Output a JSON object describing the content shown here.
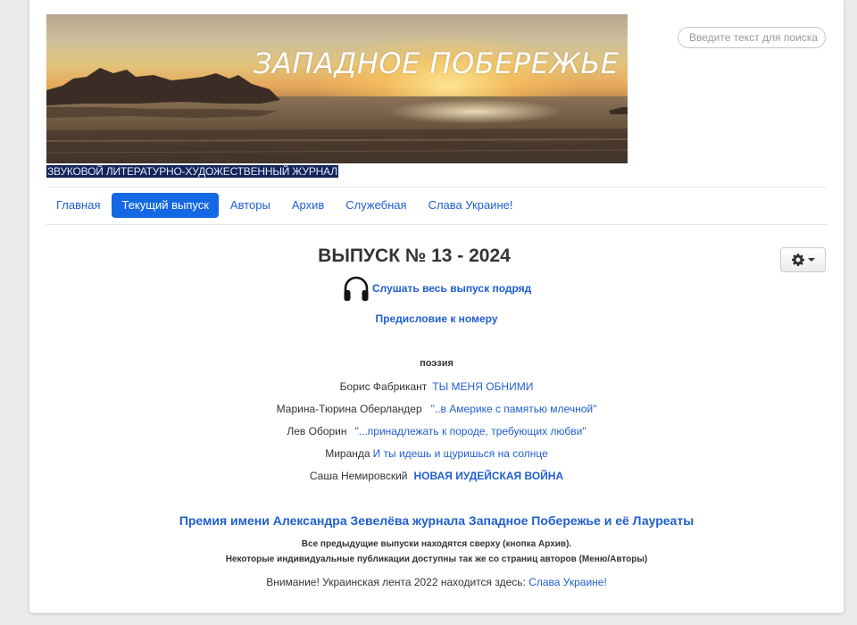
{
  "header": {
    "banner_title": "ЗАПАДНОЕ ПОБЕРЕЖЬЕ",
    "subtitle": "ЗВУКОВОЙ ЛИТЕРАТУРНО-ХУДОЖЕСТВЕННЫЙ ЖУРНАЛ",
    "search_placeholder": "Введите текст для поиска"
  },
  "nav": {
    "tabs": [
      {
        "label": "Главная"
      },
      {
        "label": "Текущий выпуск",
        "active": true
      },
      {
        "label": "Авторы"
      },
      {
        "label": "Архив"
      },
      {
        "label": "Служебная"
      },
      {
        "label": "Слава Украине!"
      }
    ]
  },
  "toolbar": {
    "gear_icon": "gear-icon",
    "caret_icon": "caret-down-icon"
  },
  "main": {
    "issue_title": "ВЫПУСК № 13 - 2024",
    "listen_icon": "headphones-icon",
    "listen_label": "Слушать весь выпуск подряд",
    "preface_label": "Предисловие к номеру",
    "section_title": "поэзия",
    "entries": [
      {
        "author": "Борис Фабрикант",
        "work": "ТЫ МЕНЯ ОБНИМИ"
      },
      {
        "author": "Марина-Тюрина Оберландер",
        "work": "\"..в Америке с памятью млечной\""
      },
      {
        "author": "Лев Оборин",
        "work": "\"...принадлежать к породе, требующих любви\""
      },
      {
        "author": "Миранда",
        "work": "И ты идешь и щуришься на солнце"
      },
      {
        "author": "Саша Немировский",
        "work": "НОВАЯ ИУДЕЙСКАЯ ВОЙНА"
      }
    ],
    "prize_label": "Премия имени Александра Зевелёва журнала Западное Побережье и её Лауреаты",
    "note1": "Все предыдущие выпуски находятся сверху (кнопка Архив).",
    "note2": "Некоторые индивидуальные публикации доступны так же со страниц авторов (Меню/Авторы)",
    "attention_text": "Внимание! Украинская лента 2022 находится здесь:",
    "attention_link": "Слава Украине!"
  }
}
